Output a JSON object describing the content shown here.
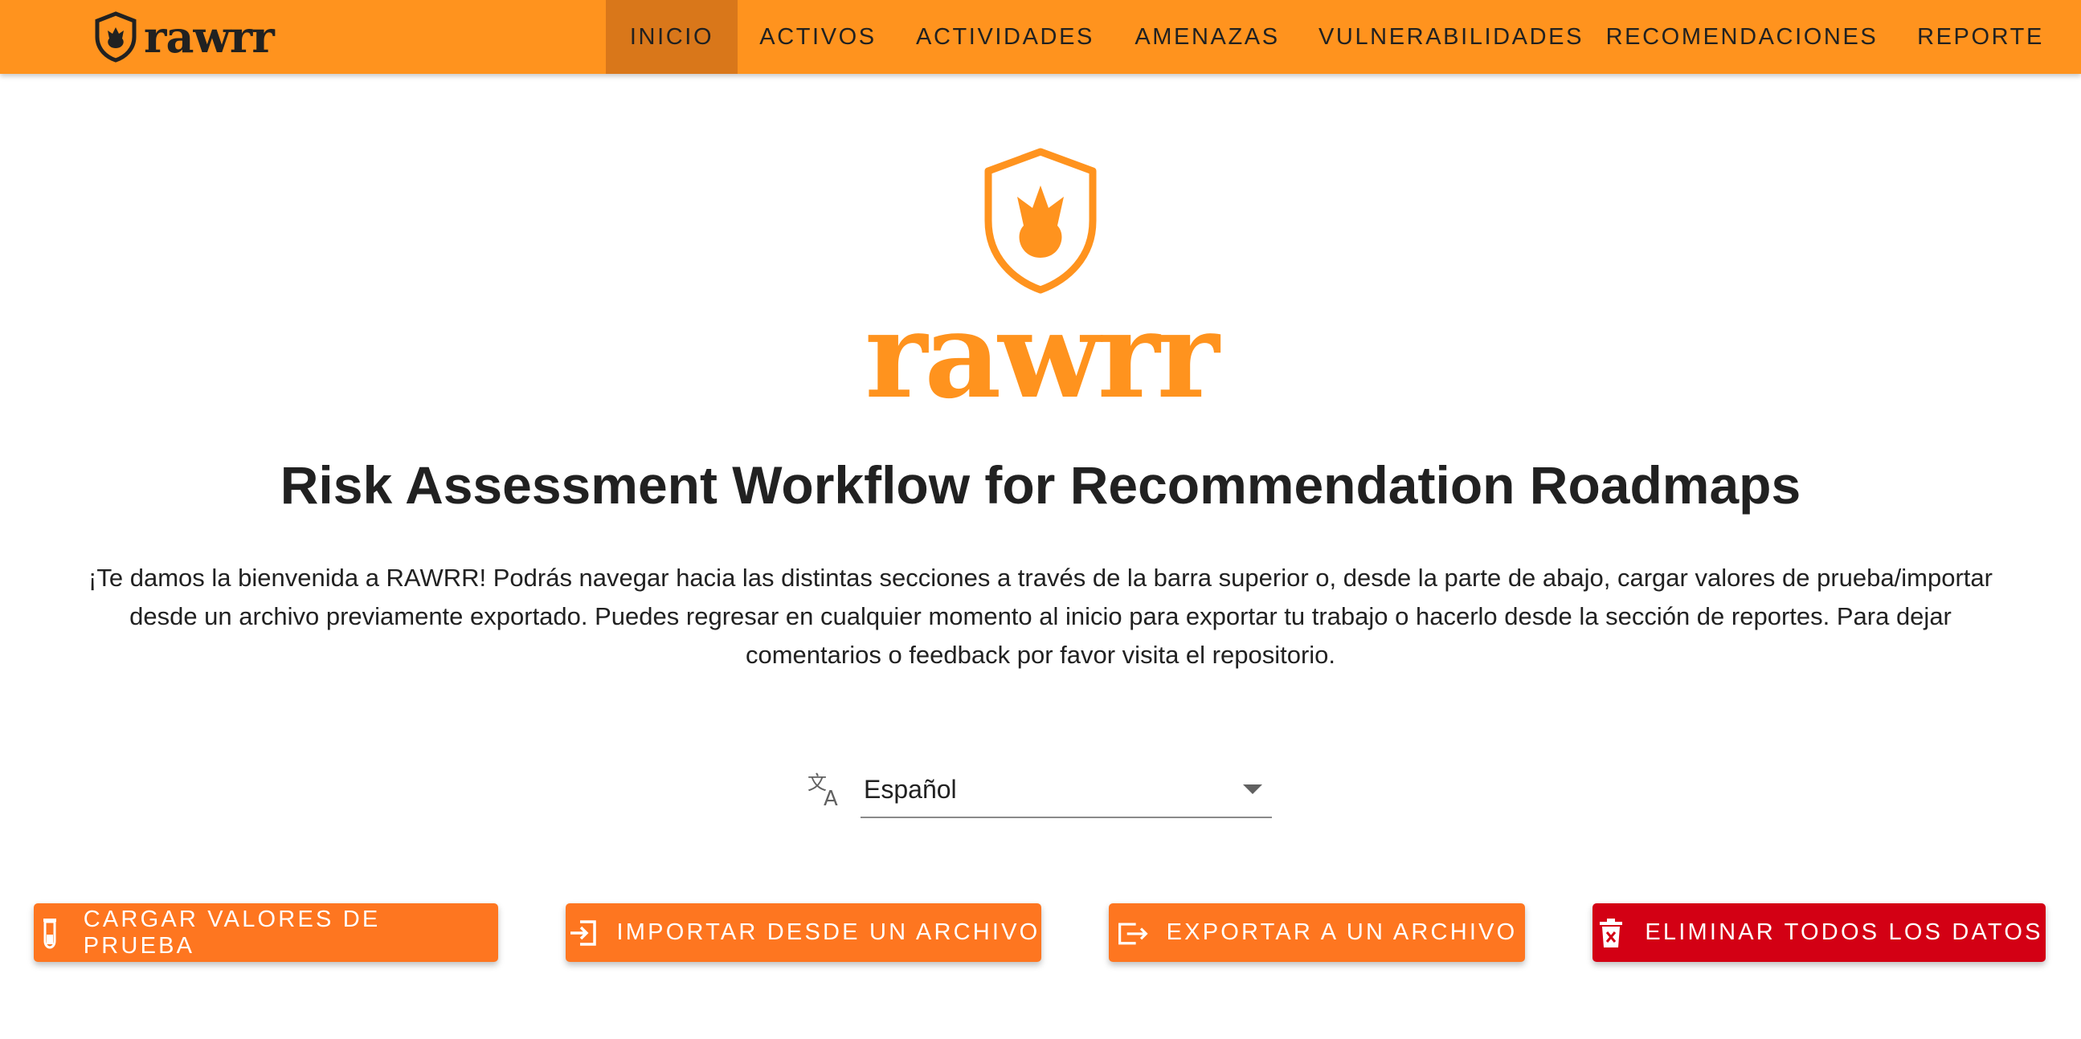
{
  "app": {
    "logo_text": "rawrr"
  },
  "nav": {
    "items": [
      {
        "label": "INICIO",
        "active": true
      },
      {
        "label": "ACTIVOS",
        "active": false
      },
      {
        "label": "ACTIVIDADES",
        "active": false
      },
      {
        "label": "AMENAZAS",
        "active": false
      },
      {
        "label": "VULNERABILIDADES",
        "active": false
      },
      {
        "label": "RECOMENDACIONES",
        "active": false
      },
      {
        "label": "REPORTE",
        "active": false
      }
    ]
  },
  "hero": {
    "wordmark": "rawrr",
    "title": "Risk Assessment Workflow for Recommendation Roadmaps",
    "intro": "¡Te damos la bienvenida a RAWRR! Podrás navegar hacia las distintas secciones a través de la barra superior o, desde la parte de abajo, cargar valores de prueba/importar desde un archivo previamente exportado. Puedes regresar en cualquier momento al inicio para exportar tu trabajo o hacerlo desde la sección de reportes. Para dejar comentarios o feedback por favor visita el repositorio."
  },
  "language": {
    "icon": "translate-icon",
    "value": "Español"
  },
  "actions": {
    "load_sample": {
      "label": "CARGAR VALORES DE PRUEBA",
      "icon": "test-tube-icon"
    },
    "import": {
      "label": "IMPORTAR DESDE UN ARCHIVO",
      "icon": "import-icon"
    },
    "export": {
      "label": "EXPORTAR A UN ARCHIVO",
      "icon": "export-icon"
    },
    "delete_all": {
      "label": "ELIMINAR TODOS LOS DATOS",
      "icon": "trash-icon"
    }
  },
  "colors": {
    "brand": "#ff931e",
    "nav_active": "#d9771a",
    "button": "#fe7620",
    "danger": "#d30014"
  }
}
